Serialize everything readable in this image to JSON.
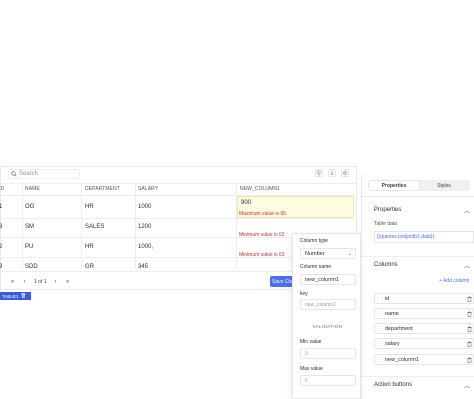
{
  "table": {
    "search_placeholder": "Search",
    "headers": [
      "ID",
      "NAME",
      "DEPARTMENT",
      "SALARY",
      "NEW_COLUMN1"
    ],
    "rows": [
      {
        "id": "1",
        "name": "OG",
        "department": "HR",
        "salary": "1000",
        "new": "900",
        "error": "Maximum value is 95"
      },
      {
        "id": "3",
        "name": "SM",
        "department": "SALES",
        "salary": "1200",
        "new": "",
        "error": "Minimum value is 63"
      },
      {
        "id": "2",
        "name": "PU",
        "department": "HR",
        "salary": "1000,",
        "new": "",
        "error": "Minimum value is 63"
      },
      {
        "id": "9",
        "name": "SDD",
        "department": "GR",
        "salary": "345",
        "new": "",
        "error": ""
      }
    ],
    "pagination": {
      "text": "1 of 1",
      "first": "«",
      "prev": "‹",
      "next": "›",
      "last": "»"
    },
    "save_label": "Save Changes",
    "tag_label": "TABLE1"
  },
  "popover": {
    "column_type_label": "Column type",
    "column_type_value": "Number",
    "column_name_label": "Column name",
    "column_name_value": "new_column1",
    "key_label": "key",
    "key_placeholder": "new_column1",
    "validation_label": "VALIDATION",
    "min_label": "Min value",
    "min_value": "3",
    "max_label": "Max value",
    "max_value": "5"
  },
  "inspector": {
    "tab_properties": "Properties",
    "tab_styles": "Styles",
    "properties_title": "Properties",
    "table_data_label": "Table data",
    "table_data_value": "{{queries.tooljetdb2.data}}",
    "columns_title": "Columns",
    "add_column": "+ Add column",
    "columns": [
      "id",
      "name",
      "department",
      "salary",
      "new_column1"
    ],
    "action_buttons_title": "Action buttons"
  },
  "colors": {
    "accent": "#4c6ef5",
    "error": "#c53030",
    "active_cell_bg": "#fffbe0"
  }
}
